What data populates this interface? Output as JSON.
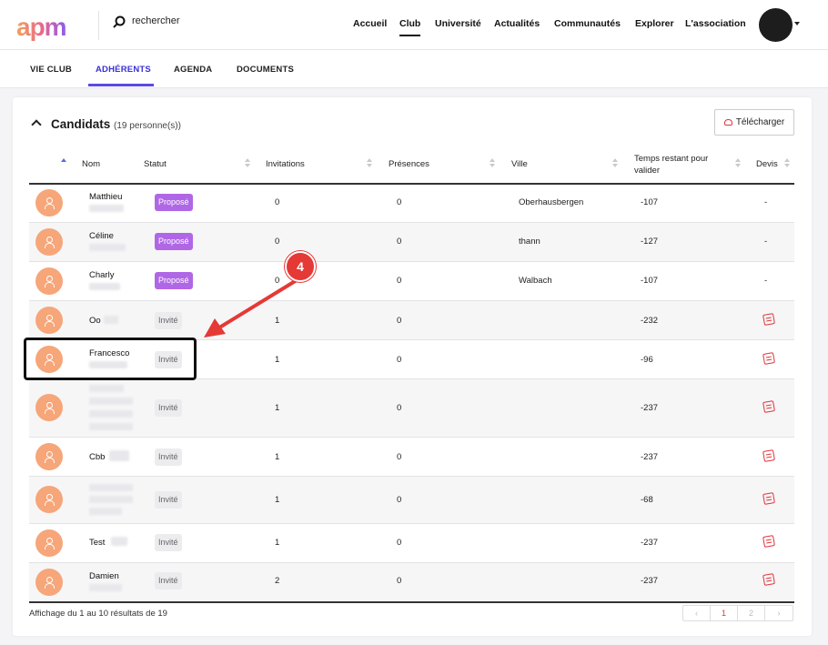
{
  "topbar": {
    "logo": "apm",
    "search_placeholder": "rechercher",
    "nav": [
      "Accueil",
      "Club",
      "Université",
      "Actualités",
      "Communautés",
      "Explorer",
      "L'association"
    ],
    "nav_active": "Club"
  },
  "subtabs": [
    "VIE CLUB",
    "ADHÉRENTS",
    "AGENDA",
    "DOCUMENTS"
  ],
  "subtab_active": "ADHÉRENTS",
  "section": {
    "title": "Candidats",
    "count": "(19 personne(s))",
    "download_label": "Télécharger"
  },
  "table": {
    "headers": [
      "Nom",
      "Statut",
      "Invitations",
      "Présences",
      "Ville",
      "Temps restant pour valider",
      "Devis"
    ],
    "rows": [
      {
        "name": "Matthieu",
        "status": "Proposé",
        "invitations": "0",
        "presences": "0",
        "ville": "Oberhausbergen",
        "temps": "-107",
        "devis": "-"
      },
      {
        "name": "Céline",
        "status": "Proposé",
        "invitations": "0",
        "presences": "0",
        "ville": "thann",
        "temps": "-127",
        "devis": "-"
      },
      {
        "name": "Charly",
        "status": "Proposé",
        "invitations": "0",
        "presences": "0",
        "ville": "Walbach",
        "temps": "-107",
        "devis": "-"
      },
      {
        "name": "Oo",
        "status": "Invité",
        "invitations": "1",
        "presences": "0",
        "ville": "",
        "temps": "-232",
        "devis": "icon"
      },
      {
        "name": "Francesco",
        "status": "Invité",
        "invitations": "1",
        "presences": "0",
        "ville": "",
        "temps": "-96",
        "devis": "icon"
      },
      {
        "name": "",
        "status": "Invité",
        "invitations": "1",
        "presences": "0",
        "ville": "",
        "temps": "-237",
        "devis": "icon"
      },
      {
        "name": "Cbb",
        "status": "Invité",
        "invitations": "1",
        "presences": "0",
        "ville": "",
        "temps": "-237",
        "devis": "icon"
      },
      {
        "name": "",
        "status": "Invité",
        "invitations": "1",
        "presences": "0",
        "ville": "",
        "temps": "-68",
        "devis": "icon"
      },
      {
        "name": "Test",
        "status": "Invité",
        "invitations": "1",
        "presences": "0",
        "ville": "",
        "temps": "-237",
        "devis": "icon"
      },
      {
        "name": "Damien",
        "status": "Invité",
        "invitations": "2",
        "presences": "0",
        "ville": "",
        "temps": "-237",
        "devis": "icon"
      }
    ]
  },
  "footer": {
    "summary": "Affichage du 1 au 10 résultats de 19",
    "prev": "‹",
    "pages": [
      "1",
      "2"
    ],
    "current_page": "1",
    "next": "›"
  },
  "annotation": {
    "step_number": "4",
    "color": "#e53935"
  },
  "colors": {
    "accent": "#5b4ae3",
    "propose_badge": "#b067e6",
    "avatar": "#f6a679",
    "devis_icon": "#e0353a"
  }
}
